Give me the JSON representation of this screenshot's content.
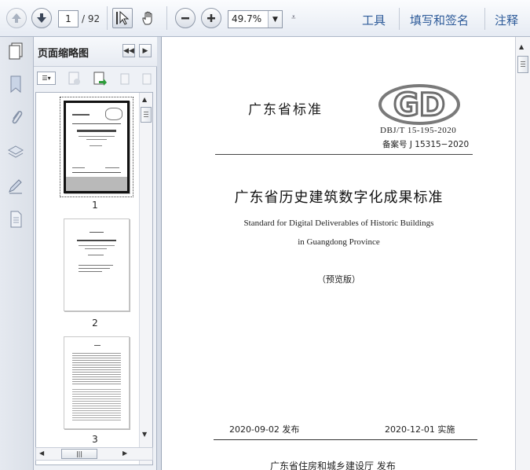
{
  "toolbar": {
    "page_current": "1",
    "page_total": "/ 92",
    "zoom": "49.7%",
    "links": [
      "工具",
      "填写和签名",
      "注释"
    ]
  },
  "panel": {
    "title": "页面缩略图",
    "thumbnails": [
      {
        "label": "1",
        "selected": true
      },
      {
        "label": "2",
        "selected": false
      },
      {
        "label": "3",
        "selected": false
      }
    ]
  },
  "document": {
    "header": "广东省标准",
    "logo_text": "GD",
    "code": "DBJ/T 15-195-2020",
    "record_no": "备案号 J 15315−2020",
    "title": "广东省历史建筑数字化成果标准",
    "english_line1": "Standard for Digital Deliverables of Historic Buildings",
    "english_line2": "in Guangdong Province",
    "preview": "（预览版）",
    "publish_date": "2020-09-02   发布",
    "effective_date": "2020-12-01    实施",
    "issuer": "广东省住房和城乡建设厅    发布"
  },
  "colors": {
    "link": "#2f5c9a",
    "toolbar_bg": "#e6ebf3",
    "panel_bg": "#eef1f6"
  }
}
